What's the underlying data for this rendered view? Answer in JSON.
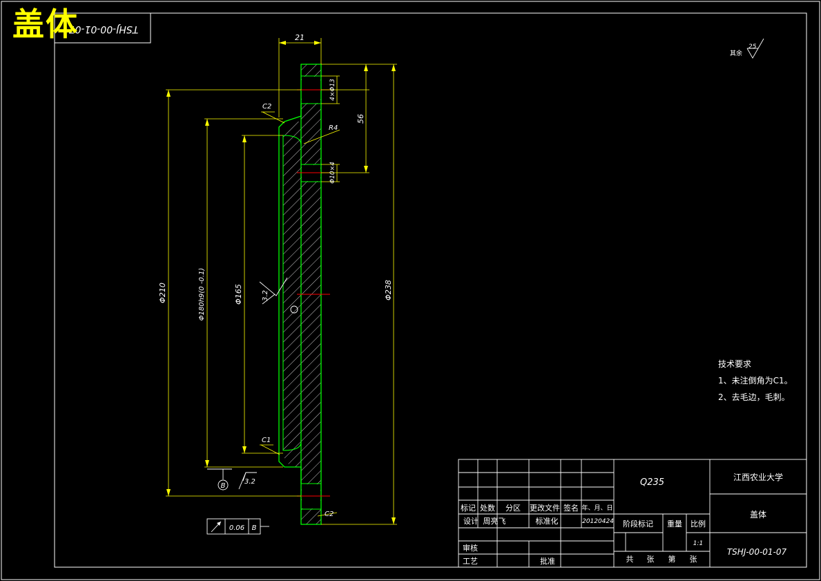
{
  "header": {
    "title": "盖体",
    "drawing_code_rotated": "TSHJ-00-01-07"
  },
  "dimensions": {
    "width_21": "21",
    "bolt_holes": "4×Φ13",
    "pitch_56": "56",
    "small_hole": "Φ10×4",
    "r4": "R4",
    "c2_top": "C2",
    "c1_bottom": "C1",
    "c2_bottom": "C2",
    "d210": "Φ210",
    "d180": "Φ180h9(0 -0.1)",
    "d165": "Φ165",
    "d238": "Φ238",
    "roughness_32": "3.2",
    "roughness_32b": "3.2",
    "datum_b": "B",
    "runout_value": "0.06",
    "runout_datum": "B"
  },
  "surface_note": {
    "label": "其余",
    "value": "25"
  },
  "tech_requirements": {
    "title": "技术要求",
    "line1": "1、未注倒角为C1。",
    "line2": "2、去毛边，毛刺。"
  },
  "title_block": {
    "material": "Q235",
    "school": "江西农业大学",
    "part_name": "盖体",
    "drawing_no": "TSHJ-00-01-07",
    "h_biaoji": "标记",
    "h_chushu": "处数",
    "h_fenqu": "分区",
    "h_genggai": "更改文件",
    "h_qianming": "签名",
    "h_date": "年、月、日",
    "sheji": "设计",
    "designer": "周亮飞",
    "biaozhunhua": "标准化",
    "date": "20120424",
    "shenhe": "审核",
    "gongyi": "工艺",
    "pizhun": "批准",
    "jieduan": "阶段标记",
    "zhongliang": "重量",
    "bili": "比例",
    "scale": "1:1",
    "gong": "共",
    "zhang1": "张",
    "di": "第",
    "zhang2": "张"
  }
}
